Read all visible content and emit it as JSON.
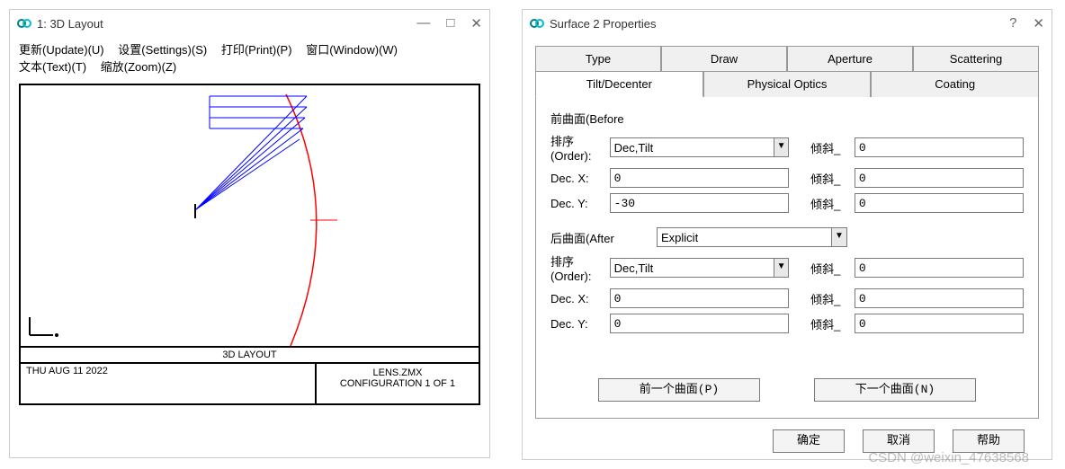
{
  "left": {
    "title": "1: 3D Layout",
    "menu": {
      "update": "更新(Update)(U)",
      "settings": "设置(Settings)(S)",
      "print": "打印(Print)(P)",
      "window": "窗口(Window)(W)",
      "text": "文本(Text)(T)",
      "zoom": "缩放(Zoom)(Z)"
    },
    "footer": {
      "line1": "3D LAYOUT",
      "date": "THU AUG 11 2022",
      "file": "LENS.ZMX",
      "config": "CONFIGURATION 1 OF 1"
    }
  },
  "right": {
    "title": "Surface 2 Properties",
    "help": "?",
    "tabs1": {
      "type": "Type",
      "draw": "Draw",
      "aperture": "Aperture",
      "scattering": "Scattering"
    },
    "tabs2": {
      "tilt": "Tilt/Decenter",
      "phys": "Physical Optics",
      "coating": "Coating"
    },
    "form": {
      "before_label": "前曲面(Before",
      "order_label": "排序\n(Order):",
      "order_label_text": "排序(Order):",
      "before_order": "Dec,Tilt",
      "tilt_label": "倾斜_",
      "before_tilt": "0",
      "decx_label": "Dec. X:",
      "before_decx": "0",
      "before_tilt_x": "0",
      "decy_label": "Dec. Y:",
      "before_decy": "-30",
      "before_tilt_y": "0",
      "after_label": "后曲面(After",
      "after_mode": "Explicit",
      "after_order": "Dec,Tilt",
      "after_tilt": "0",
      "after_decx": "0",
      "after_tilt_x": "0",
      "after_decy": "0",
      "after_tilt_y": "0",
      "prev_btn": "前一个曲面(P)",
      "next_btn": "下一个曲面(N)"
    },
    "buttons": {
      "ok": "确定",
      "cancel": "取消",
      "help_btn": "帮助"
    }
  },
  "watermark": "CSDN @weixin_47638568"
}
